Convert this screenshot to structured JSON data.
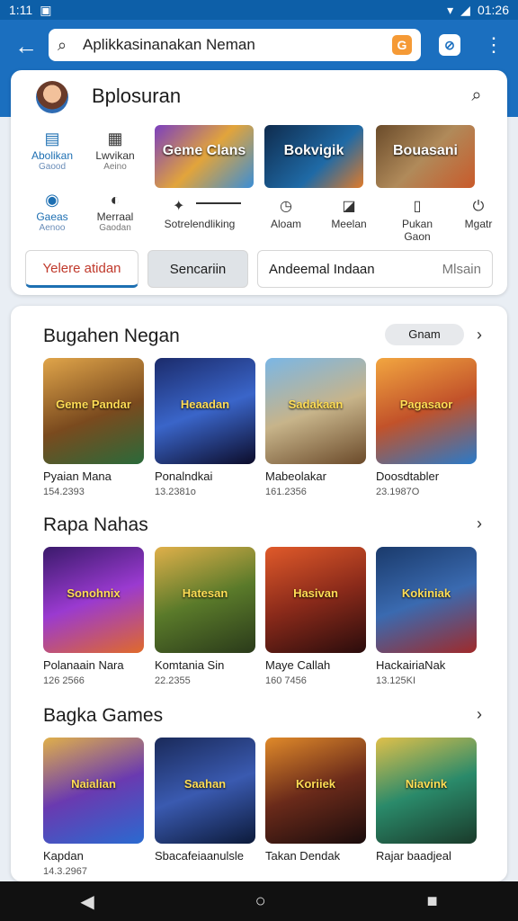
{
  "status": {
    "time": "1:11",
    "right": "01:26"
  },
  "search": {
    "value": "Aplikkasinanakan Neman"
  },
  "header": {
    "title": "Bplosuran"
  },
  "top_icons": [
    {
      "label": "Abolikan",
      "sub": "Gaood"
    },
    {
      "label": "Lwvikan",
      "sub": "Aeino"
    },
    {
      "label": "Gaeas",
      "sub": "Aenoo"
    },
    {
      "label": "Merraal",
      "sub": "Gaodan"
    }
  ],
  "banners": [
    "Geme Clans",
    "Bokvigik",
    "Bouasani"
  ],
  "categories": [
    "Sotrelendliking",
    "Aloam",
    "Meelan",
    "Pukan",
    "Mgatr"
  ],
  "category_sub": {
    "pukan": "Gaon"
  },
  "tabs": [
    "Yelere atidan",
    "Sencariin",
    "Andeemal Indaan",
    "Mlsain"
  ],
  "sections": [
    {
      "title": "Bugahen Negan",
      "pill": "Gnam",
      "apps": [
        {
          "name": "Pyaian Mana",
          "size": "154.2393",
          "art": "Geme Pandar"
        },
        {
          "name": "Ponalndkai",
          "size": "13.2381o",
          "art": "Heaadan"
        },
        {
          "name": "Mabeolakar",
          "size": "161.2356",
          "art": "Sadakaan"
        },
        {
          "name": "Doosdtabler",
          "size": "23.1987O",
          "art": "Pagasaor"
        }
      ]
    },
    {
      "title": "Rapa Nahas",
      "pill": "",
      "apps": [
        {
          "name": "Polanaain Nara",
          "size": "126 2566",
          "art": "Sonohnix"
        },
        {
          "name": "Komtania Sin",
          "size": "22.2355",
          "art": "Hatesan"
        },
        {
          "name": "Maye Callah",
          "size": "160 7456",
          "art": "Hasivan"
        },
        {
          "name": "HackairiaNak",
          "size": "13.125KI",
          "art": "Kokiniak"
        }
      ]
    },
    {
      "title": "Bagka Games",
      "pill": "",
      "apps": [
        {
          "name": "Kapdan",
          "size": "14.3.2967",
          "art": "Naialian"
        },
        {
          "name": "Sbacafeiaanulsle",
          "size": "",
          "art": "Saahan"
        },
        {
          "name": "Takan Dendak",
          "size": "",
          "art": "Koriiek"
        },
        {
          "name": "Rajar baadjeal",
          "size": "",
          "art": "Niavink"
        }
      ]
    }
  ],
  "colors": {
    "primary": "#1b6fbf",
    "accent_tab": "#c0392b"
  }
}
